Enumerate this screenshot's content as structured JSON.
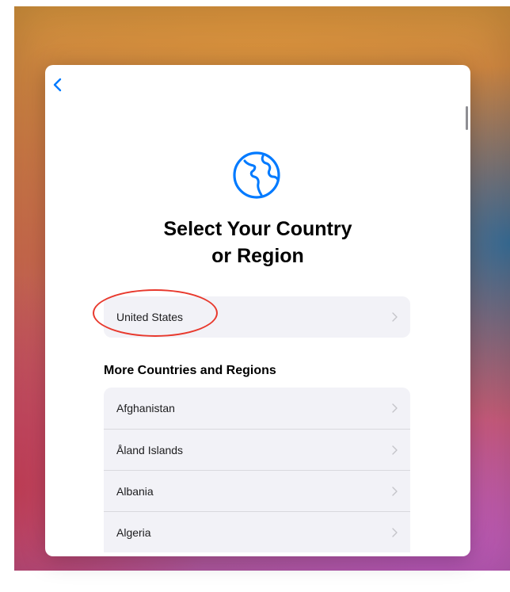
{
  "sheet": {
    "title_line1": "Select Your Country",
    "title_line2": "or Region",
    "back_icon": "chevron-left-icon",
    "header_icon": "globe-icon",
    "accent_color": "#007aff"
  },
  "suggested": {
    "label": "United States",
    "annotated": true,
    "annotation_color": "#e8392d"
  },
  "more": {
    "header": "More Countries and Regions",
    "items": [
      {
        "label": "Afghanistan"
      },
      {
        "label": "Åland Islands"
      },
      {
        "label": "Albania"
      },
      {
        "label": "Algeria"
      }
    ]
  }
}
